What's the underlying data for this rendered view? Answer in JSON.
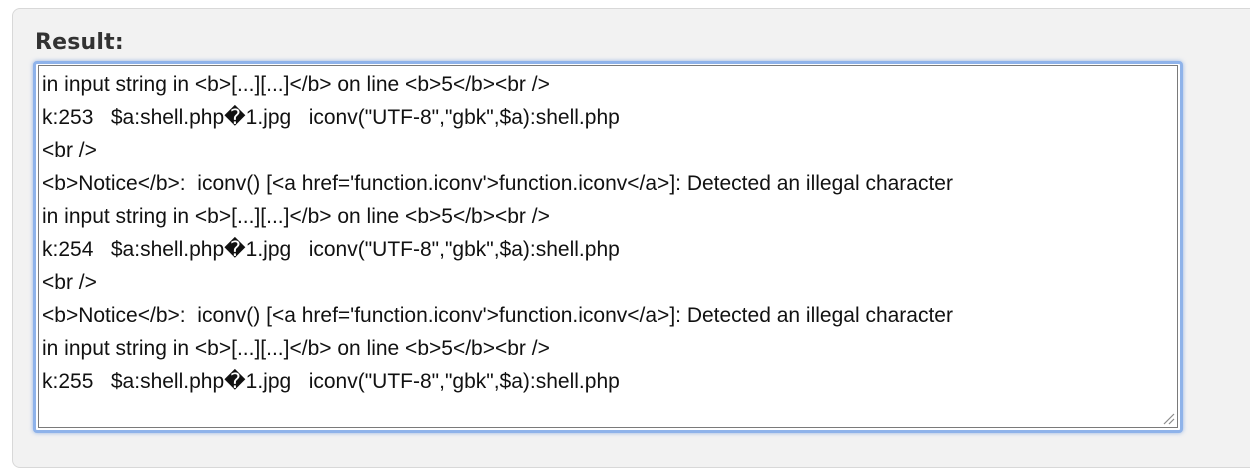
{
  "section": {
    "label": "Result:"
  },
  "output": {
    "lines": [
      "in input string in <b>[...][...]</b> on line <b>5</b><br />",
      "k:253   $a:shell.php�1.jpg   iconv(\"UTF-8\",\"gbk\",$a):shell.php",
      "<br />",
      "<b>Notice</b>:  iconv() [<a href='function.iconv'>function.iconv</a>]: Detected an illegal character",
      "in input string in <b>[...][...]</b> on line <b>5</b><br />",
      "k:254   $a:shell.php�1.jpg   iconv(\"UTF-8\",\"gbk\",$a):shell.php",
      "<br />",
      "<b>Notice</b>:  iconv() [<a href='function.iconv'>function.iconv</a>]: Detected an illegal character",
      "in input string in <b>[...][...]</b> on line <b>5</b><br />",
      "k:255   $a:shell.php�1.jpg   iconv(\"UTF-8\",\"gbk\",$a):shell.php"
    ]
  },
  "colors": {
    "focus_ring": "#8fb3ea",
    "panel_bg": "#f2f2f2",
    "label": "#333333",
    "text": "#111111"
  },
  "icons": {
    "resize": "resize-handle-icon"
  }
}
